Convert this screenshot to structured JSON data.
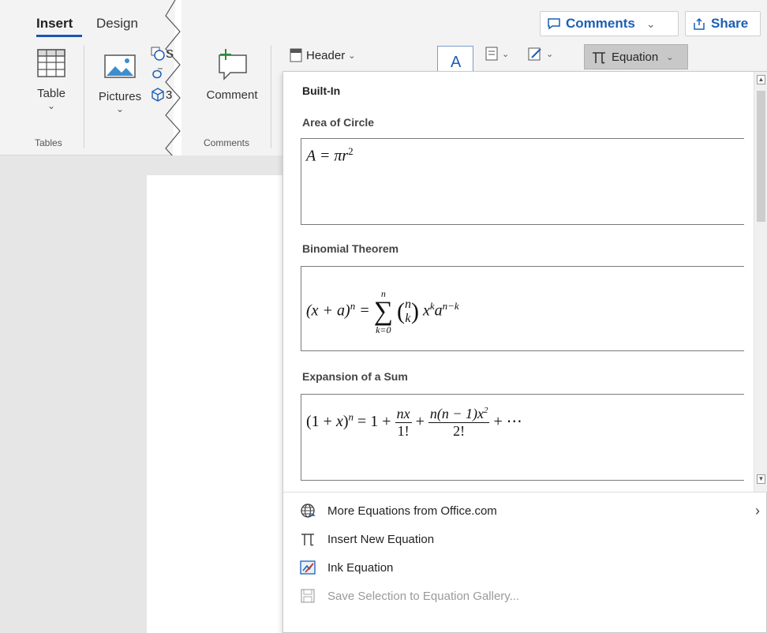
{
  "tabs": {
    "insert": "Insert",
    "design": "Design"
  },
  "top_buttons": {
    "comments": "Comments",
    "share": "Share"
  },
  "ribbon": {
    "table": "Table",
    "pictures": "Pictures",
    "shapes_partial": "Sh",
    "icons_partial": "3",
    "comment": "Comment",
    "header": "Header",
    "equation": "Equation",
    "groups": {
      "tables": "Tables",
      "comments": "Comments"
    }
  },
  "gallery": {
    "title": "Built-In",
    "items": [
      {
        "title": "Area of Circle",
        "formula": "A = πr²"
      },
      {
        "title": "Binomial Theorem",
        "formula": "(x + a)ⁿ = Σₖ₌₀ⁿ (n k) xᵏaⁿ⁻ᵏ"
      },
      {
        "title": "Expansion of a Sum",
        "formula": "(1 + x)ⁿ = 1 + nx/1! + n(n − 1)x²/2! + ⋯"
      }
    ]
  },
  "menu": {
    "more": "More Equations from Office.com",
    "insert_new": "Insert New Equation",
    "ink": "Ink Equation",
    "save": "Save Selection to Equation Gallery..."
  },
  "colors": {
    "accent": "#1a55b3",
    "ribbon_bg": "#f3f3f3",
    "doc_bg": "#e6e6e6"
  },
  "icons": [
    "table-icon",
    "pictures-icon",
    "shapes-icon",
    "icons-icon",
    "3d-models-icon",
    "new-comment-icon",
    "header-icon",
    "text-box-icon",
    "quick-parts-icon",
    "signature-icon",
    "pi-icon",
    "globe-icon",
    "ink-icon",
    "save-icon",
    "comment-bubble-icon",
    "share-icon"
  ]
}
